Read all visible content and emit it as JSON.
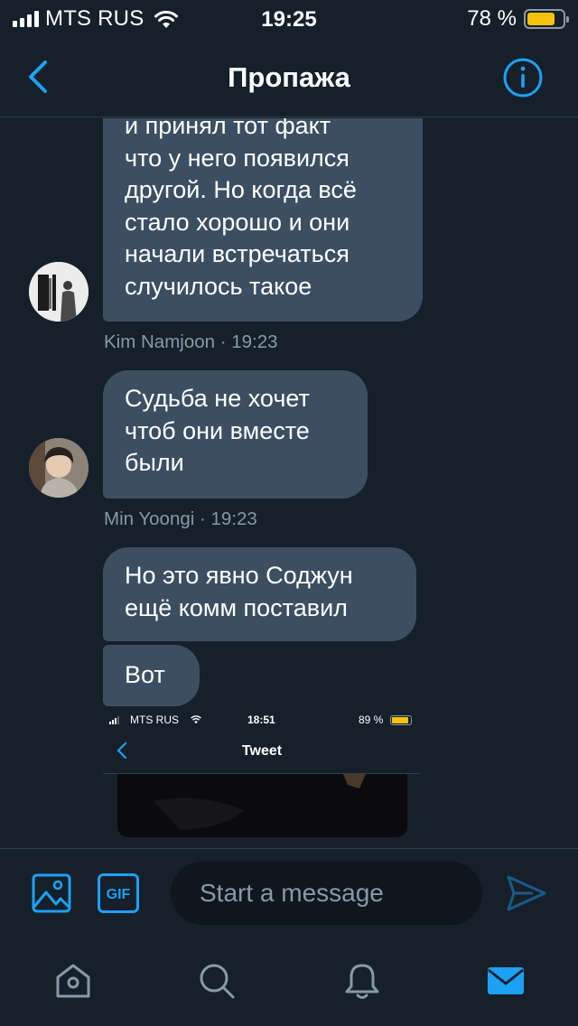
{
  "status_bar": {
    "carrier": "MTS RUS",
    "time": "19:25",
    "battery_percent": "78 %",
    "battery_level": 0.78,
    "signal_bars": 4
  },
  "nav": {
    "title": "Пропажа",
    "back_icon": "chevron-left-icon",
    "info_icon": "info-icon"
  },
  "messages": [
    {
      "text": "и принял тот факт\nчто у него появился\nдругой. Но когда всё\nстало хорошо и они\nначали встречаться\nслучилось такое"
    },
    {
      "text": "Судьба не хочет\nчтоб они вместе\nбыли"
    },
    {
      "text": "Но это явно Соджун\nещё комм поставил"
    },
    {
      "text": "Вот"
    }
  ],
  "meta": [
    {
      "text": "Kim Namjoon · 19:23"
    },
    {
      "text": "Min Yoongi · 19:23"
    }
  ],
  "attachment": {
    "carrier": "MTS RUS",
    "time": "18:51",
    "battery_percent": "89 %",
    "battery_level": 0.89,
    "title": "Tweet"
  },
  "composer": {
    "placeholder": "Start a message",
    "value": "",
    "gif_label": "GIF"
  },
  "tabs": [
    {
      "icon": "home-icon"
    },
    {
      "icon": "search-icon"
    },
    {
      "icon": "bell-icon"
    },
    {
      "icon": "mail-icon",
      "active": true
    }
  ],
  "colors": {
    "background": "#15202b",
    "bubble": "#3c4f62",
    "accent": "#1da1f2",
    "muted": "#8899a6"
  }
}
